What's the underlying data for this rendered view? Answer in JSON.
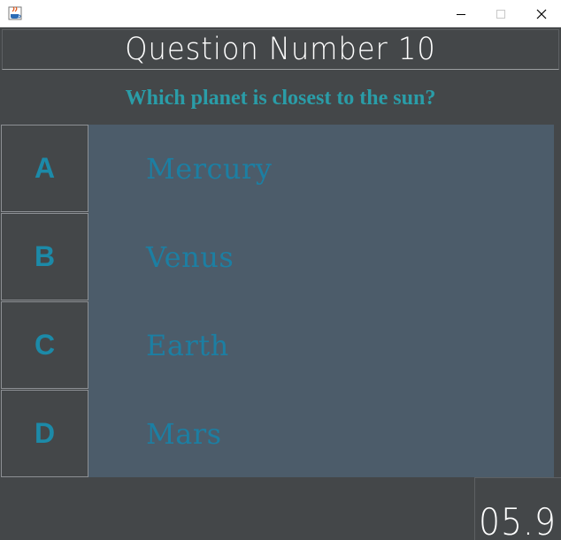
{
  "window": {
    "app_icon": "java-cup-icon",
    "controls": [
      "minimize-icon",
      "maximize-icon",
      "close-icon"
    ]
  },
  "quiz": {
    "header": "Question Number 10",
    "question": "Which planet is closest to the sun?",
    "options": [
      {
        "letter": "A",
        "answer": "Mercury"
      },
      {
        "letter": "B",
        "answer": "Venus"
      },
      {
        "letter": "C",
        "answer": "Earth"
      },
      {
        "letter": "D",
        "answer": "Mars"
      }
    ],
    "timer": "05.9"
  },
  "colors": {
    "background": "#444749",
    "answer_panel": "#4c5c6a",
    "accent": "#1c8aa8",
    "question": "#2a9da8",
    "header_text": "#ffffff"
  }
}
